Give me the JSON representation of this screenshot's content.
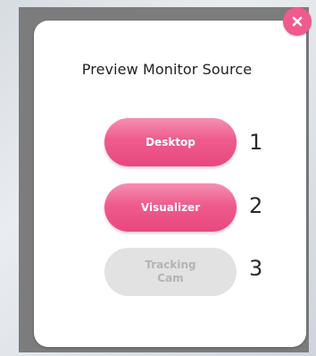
{
  "dialog": {
    "title": "Preview Monitor Source",
    "close_icon": "close-icon",
    "options": [
      {
        "label": "Desktop",
        "number": "1",
        "state": "active"
      },
      {
        "label": "Visualizer",
        "number": "2",
        "state": "active"
      },
      {
        "label": "Tracking\nCam",
        "number": "3",
        "state": "disabled"
      }
    ]
  },
  "colors": {
    "accent": "#ee5b8d",
    "disabled_bg": "#e2e2e2",
    "disabled_text": "#b4b4b4"
  }
}
